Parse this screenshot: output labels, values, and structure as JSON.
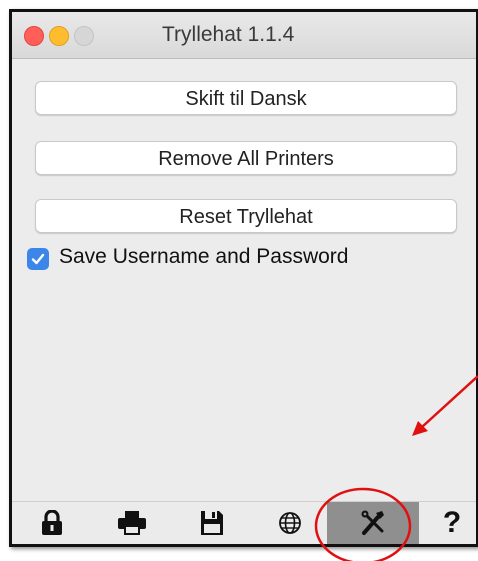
{
  "window": {
    "title": "Tryllehat 1.1.4",
    "traffic_lights": [
      "close",
      "minimize",
      "zoom"
    ]
  },
  "buttons": {
    "language_label": "Skift til Dansk",
    "remove_printers_label": "Remove All Printers",
    "reset_label": "Reset Tryllehat"
  },
  "checkbox": {
    "label": "Save Username and Password",
    "checked": true
  },
  "toolbar": {
    "items": [
      {
        "icon": "lock-icon",
        "active": false
      },
      {
        "icon": "printer-icon",
        "active": false
      },
      {
        "icon": "save-disk-icon",
        "active": false
      },
      {
        "icon": "globe-icon",
        "active": false
      },
      {
        "icon": "tools-icon",
        "active": true
      },
      {
        "icon": "help-icon",
        "label": "?",
        "active": false
      }
    ]
  },
  "annotations": {
    "arrow_color": "#e01010",
    "circle_color": "#e01010"
  },
  "colors": {
    "accent": "#3b86e8",
    "active_tool_bg": "#8f8f8f"
  }
}
